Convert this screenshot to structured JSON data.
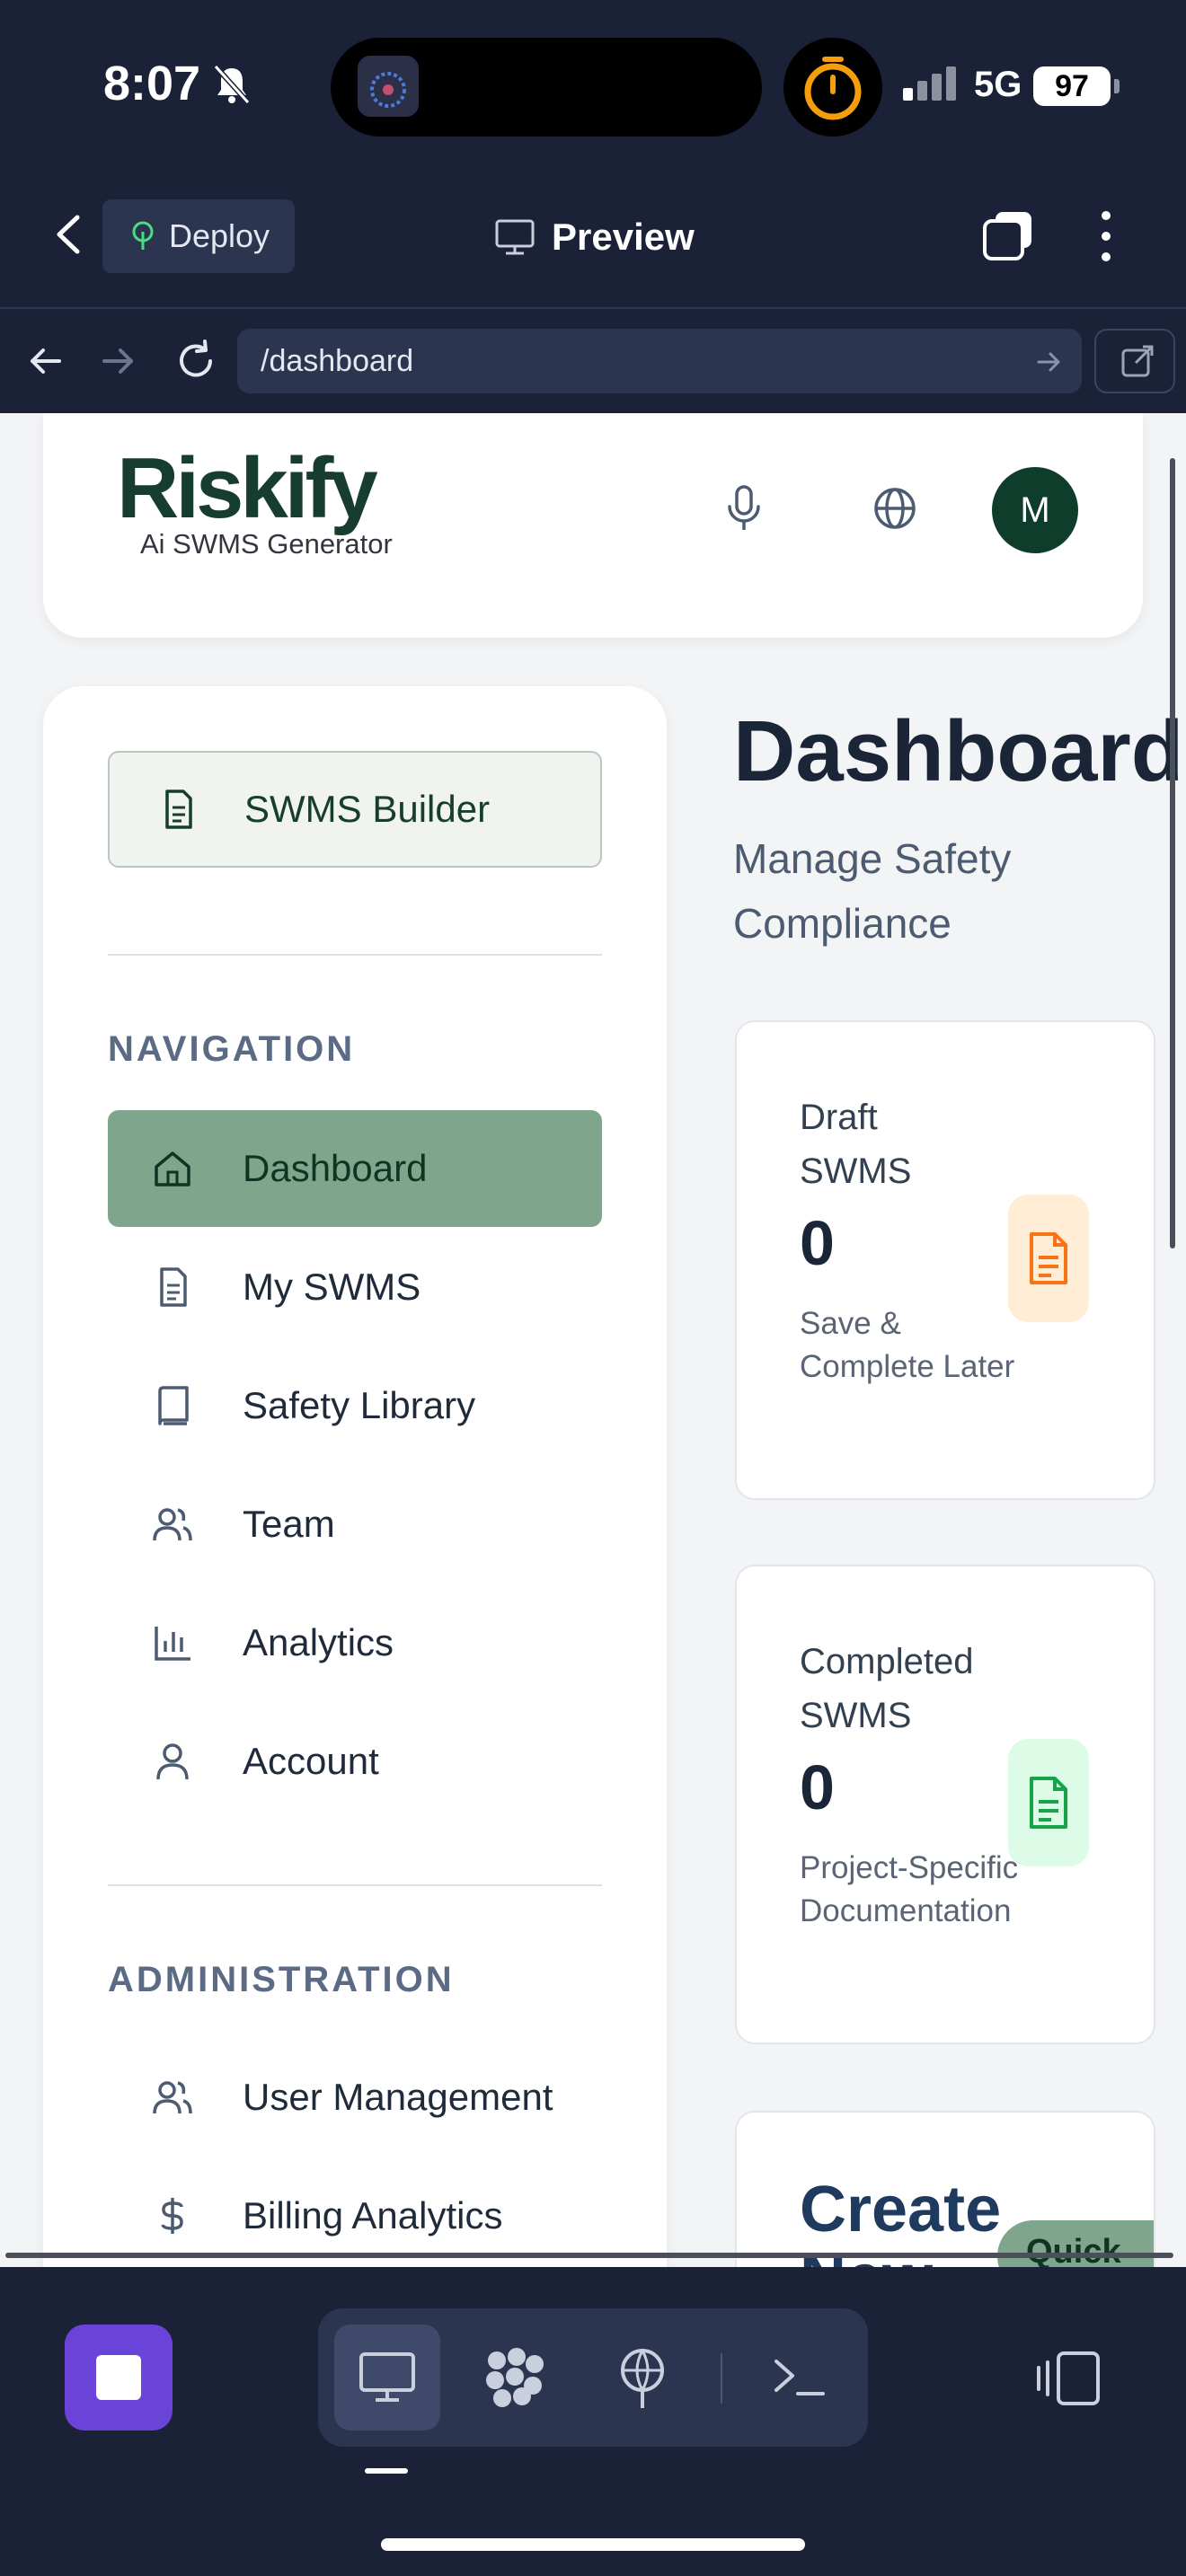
{
  "status_bar": {
    "time": "8:07",
    "network": "5G",
    "battery": "97"
  },
  "app_header": {
    "deploy_label": "Deploy",
    "preview_label": "Preview"
  },
  "address_bar": {
    "url": "/dashboard"
  },
  "site_header": {
    "logo_main": "Riskify",
    "logo_tagline": "Ai SWMS Generator",
    "avatar_initial": "M"
  },
  "sidebar": {
    "builder_label": "SWMS Builder",
    "navigation_title": "NAVIGATION",
    "nav_items": [
      {
        "label": "Dashboard",
        "icon": "home-icon",
        "active": true
      },
      {
        "label": "My SWMS",
        "icon": "document-icon"
      },
      {
        "label": "Safety Library",
        "icon": "book-icon"
      },
      {
        "label": "Team",
        "icon": "users-icon"
      },
      {
        "label": "Analytics",
        "icon": "bar-chart-icon"
      },
      {
        "label": "Account",
        "icon": "user-icon"
      }
    ],
    "admin_title": "ADMINISTRATION",
    "admin_items": [
      {
        "label": "User Management",
        "icon": "users-icon"
      },
      {
        "label": "Billing Analytics",
        "icon": "dollar-icon"
      }
    ]
  },
  "main": {
    "title": "Dashboard",
    "subtitle": "Manage Safety Compliance",
    "cards": [
      {
        "label": "Draft SWMS",
        "value": "0",
        "description": "Save & Complete Later",
        "icon": "document-icon",
        "accent": "#f97316",
        "accent_bg": "#ffedd5"
      },
      {
        "label": "Completed SWMS",
        "value": "0",
        "description": "Project-Specific Documentation",
        "icon": "document-icon",
        "accent": "#16a34a",
        "accent_bg": "#dcfce7"
      }
    ],
    "create_card": {
      "title": "Create New",
      "badge": "Quick"
    }
  },
  "colors": {
    "brand_dark": "#173d2f",
    "active_nav": "#7fa58d",
    "toolbar_bg": "#1b2238",
    "stop_button": "#6a43d8"
  }
}
